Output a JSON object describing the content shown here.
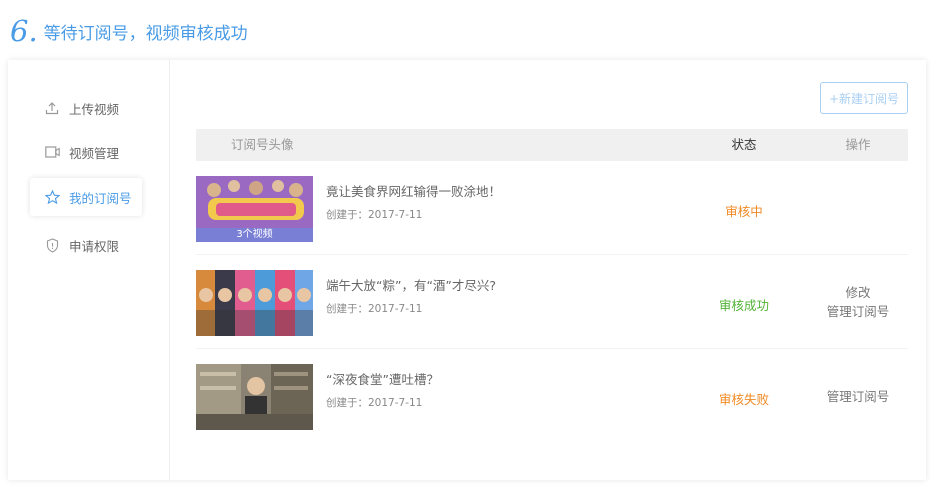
{
  "heading": {
    "number": "6.",
    "title": "等待订阅号，视频审核成功"
  },
  "colors": {
    "accent": "#4a9be6",
    "pending": "#f08a24",
    "success": "#52b337",
    "failed": "#f08a24"
  },
  "sidebar": {
    "items": [
      {
        "label": "上传视频",
        "icon": "upload-icon",
        "active": false
      },
      {
        "label": "视频管理",
        "icon": "video-icon",
        "active": false
      },
      {
        "label": "我的订阅号",
        "icon": "star-icon",
        "active": true
      },
      {
        "label": "申请权限",
        "icon": "shield-icon",
        "active": false
      }
    ]
  },
  "main": {
    "new_button": "+新建订阅号",
    "columns": {
      "avatar": "订阅号头像",
      "status": "状态",
      "ops": "操作"
    },
    "rows": [
      {
        "title": "竟让美食界网红输得一败涂地！",
        "date": "创建于：2017-7-11",
        "status": "审核中",
        "ops": [],
        "thumb_caption": "3个视频"
      },
      {
        "title": "端午大放“粽”，有“酒”才尽兴?",
        "date": "创建于：2017-7-11",
        "status": "审核成功",
        "ops": [
          "修改",
          "管理订阅号"
        ]
      },
      {
        "title": "“深夜食堂”遭吐槽？",
        "date": "创建于：2017-7-11",
        "status": "审核失败",
        "ops": [
          "管理订阅号"
        ]
      }
    ]
  }
}
